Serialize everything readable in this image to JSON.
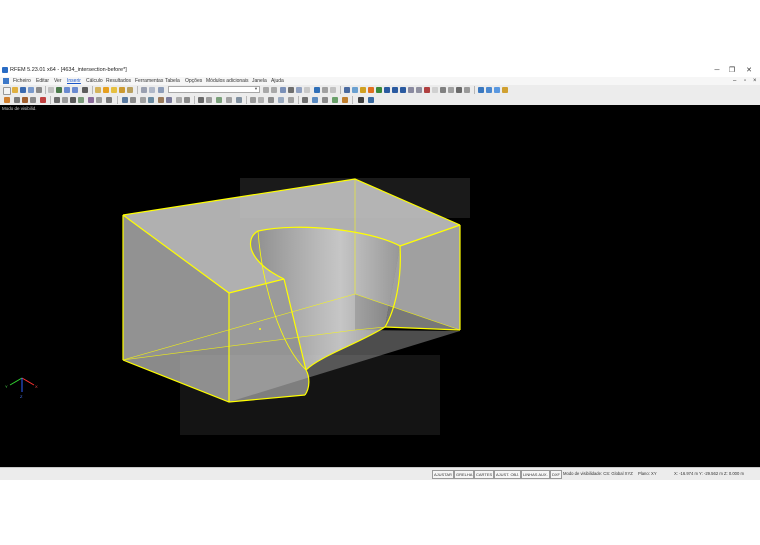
{
  "window": {
    "title": "RFEM 5.23.01 x64 - [4634_intersection-before*]",
    "minimize_glyph": "─",
    "restore_glyph": "❐",
    "close_glyph": "✕"
  },
  "menu": {
    "items": [
      "Ficheiro",
      "Editar",
      "Ver",
      "Inserir",
      "Cálculo",
      "Resultados",
      "Ferramentas",
      "Tabela",
      "Opções",
      "Módulos adicionais",
      "Janela",
      "Ajuda"
    ],
    "active": "Inserir"
  },
  "viewport": {
    "label": "Modo de visibilid.",
    "background": "#000000",
    "edge_color": "#ffff00",
    "face_color": "#c8c8c8"
  },
  "statusbar": {
    "buttons": [
      "AJUSTAR",
      "GRELHA",
      "CARTES",
      "AJUST. OBJ.",
      "LINHAS AUX.",
      "DXF"
    ],
    "mode": "Modo de visibilidade: CS: Global XYZ",
    "plane": "Plano: XY",
    "coords": "X: -16.974 m   Y: -29.562 m   Z: 0.000 m"
  },
  "axes": {
    "x": "X",
    "y": "Y",
    "z": "Z"
  }
}
